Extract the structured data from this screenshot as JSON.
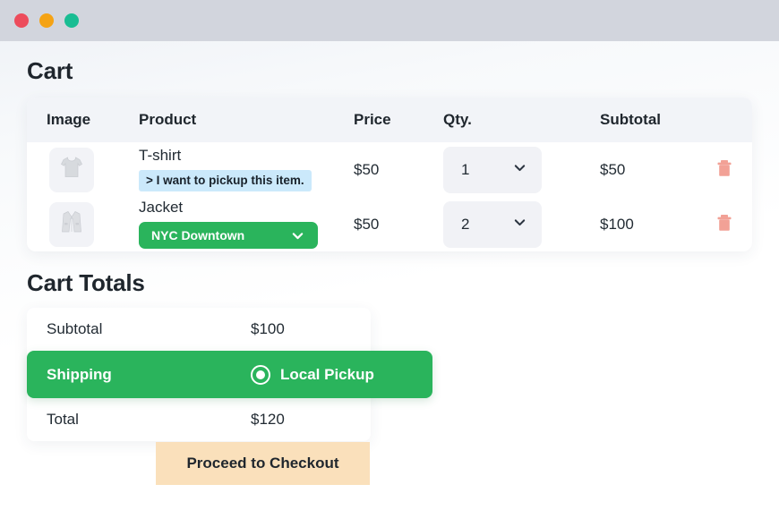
{
  "window": {
    "traffic_lights": [
      {
        "name": "close",
        "color": "#ed4c5c"
      },
      {
        "name": "minimize",
        "color": "#f5a314"
      },
      {
        "name": "maximize",
        "color": "#19bd93"
      }
    ]
  },
  "cart": {
    "title": "Cart",
    "columns": {
      "image": "Image",
      "product": "Product",
      "price": "Price",
      "qty": "Qty.",
      "subtotal": "Subtotal",
      "remove": ""
    },
    "rows": [
      {
        "thumb_icon": "tshirt-icon",
        "product": "T-shirt",
        "pickup_link": "> I want to pickup this item.",
        "pickup_location": null,
        "price": "$50",
        "qty": "1",
        "subtotal": "$50",
        "remove_icon": "trash-icon"
      },
      {
        "thumb_icon": "jacket-icon",
        "product": "Jacket",
        "pickup_link": null,
        "pickup_location": "NYC Downtown",
        "price": "$50",
        "qty": "2",
        "subtotal": "$100",
        "remove_icon": "trash-icon"
      }
    ]
  },
  "totals": {
    "title": "Cart Totals",
    "subtotal_label": "Subtotal",
    "subtotal_value": "$100",
    "shipping_label": "Shipping",
    "shipping_option": "Local Pickup",
    "total_label": "Total",
    "total_value": "$120"
  },
  "checkout": {
    "label": "Proceed to Checkout"
  },
  "colors": {
    "accent_green": "#2ab45c",
    "highlight_blue": "#cbe9fb",
    "checkout_peach": "#fae0bb",
    "trash_salmon": "#f2a196",
    "titlebar": "#d2d5dd",
    "table_header": "#f2f4f8"
  }
}
